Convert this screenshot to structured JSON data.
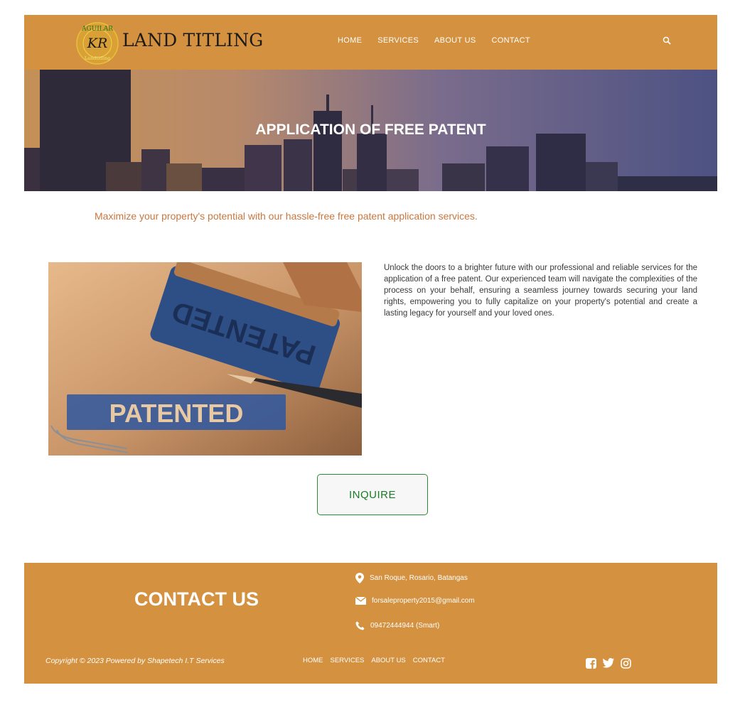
{
  "header": {
    "logo_seal_text": "AGUILAR",
    "logo_seal_sub": "Landtitling",
    "logo_initials": "KR",
    "logo_text": "LAND TITLING",
    "nav": [
      "HOME",
      "SERVICES",
      "ABOUT US",
      "CONTACT"
    ],
    "search_icon": "search-icon"
  },
  "hero": {
    "title": "APPLICATION OF FREE PATENT"
  },
  "tagline": "Maximize your property's potential with our hassle-free free patent application services.",
  "main": {
    "photo_stamp_text": "PATENTED",
    "photo_label_text": "PATENTED",
    "description": "Unlock the doors to a brighter future with our professional and reliable services for the application of a free patent. Our experienced team will navigate the complexities of the process on your behalf, ensuring a seamless journey towards securing your land rights, empowering you to fully capitalize on your property's potential and create a lasting legacy for yourself and your loved ones."
  },
  "inquire_label": "INQUIRE",
  "footer": {
    "heading": "CONTACT US",
    "address": "San Roque, Rosario, Batangas",
    "email": "forsaleproperty2015@gmail.com",
    "phone": "09472444944 (Smart)",
    "copyright": "Copyright © 2023 Powered by Shapetech I.T Services",
    "nav": [
      "HOME",
      "SERVICES",
      "ABOUT US",
      "CONTACT"
    ],
    "social": [
      "facebook-icon",
      "twitter-icon",
      "instagram-icon"
    ]
  },
  "colors": {
    "brand": "#d4913f",
    "accent_text": "#c8773e",
    "button_green": "#2e8a35"
  }
}
